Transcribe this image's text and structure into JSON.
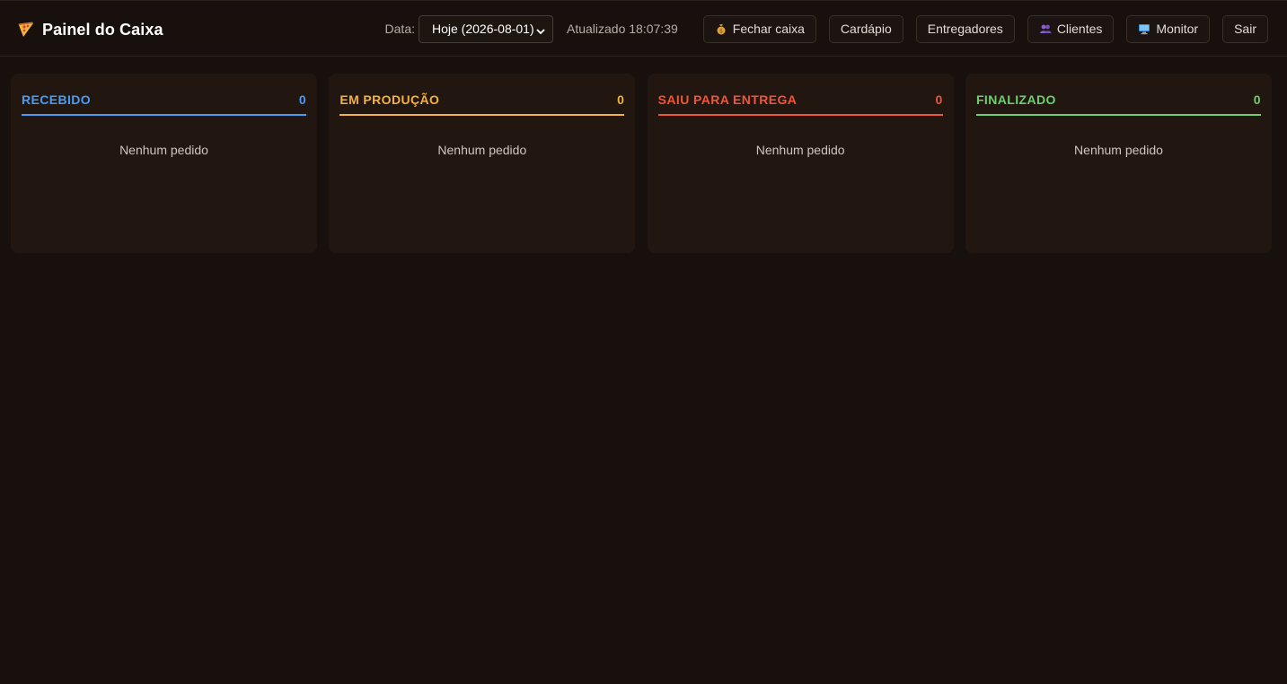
{
  "header": {
    "title": "Painel do Caixa",
    "brand_icon": "pizza-icon",
    "date_label": "Data:",
    "date_value": "Hoje (2026-08-01)",
    "updated_text": "Atualizado 18:07:39",
    "buttons": [
      {
        "label": "Fechar caixa",
        "icon": "money-bag-icon"
      },
      {
        "label": "Cardápio",
        "icon": ""
      },
      {
        "label": "Entregadores",
        "icon": ""
      },
      {
        "label": "Clientes",
        "icon": "users-icon"
      },
      {
        "label": "Monitor",
        "icon": "monitor-icon"
      },
      {
        "label": "Sair",
        "icon": ""
      }
    ]
  },
  "columns": [
    {
      "title": "RECEBIDO",
      "count": "0",
      "empty_text": "Nenhum pedido",
      "color": "#4a9bf5"
    },
    {
      "title": "EM PRODUÇÃO",
      "count": "0",
      "empty_text": "Nenhum pedido",
      "color": "#f4b13f"
    },
    {
      "title": "SAIU PARA ENTREGA",
      "count": "0",
      "empty_text": "Nenhum pedido",
      "color": "#f0553a"
    },
    {
      "title": "FINALIZADO",
      "count": "0",
      "empty_text": "Nenhum pedido",
      "color": "#6fcf6f"
    }
  ],
  "colors": {
    "background": "#17100c",
    "card": "#211710"
  }
}
